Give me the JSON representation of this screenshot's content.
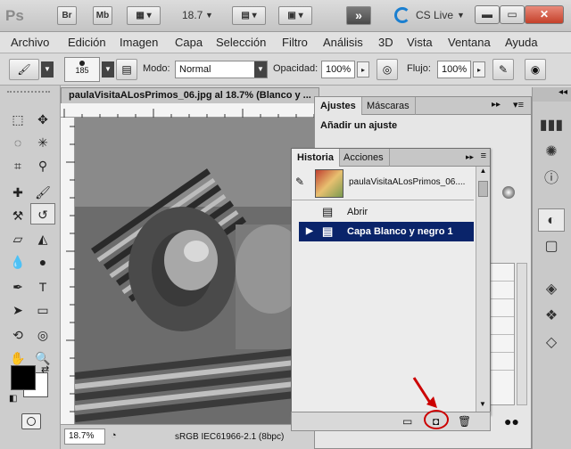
{
  "titlebar": {
    "app": "Ps",
    "bridge": "Br",
    "minibridge": "Mb",
    "zoom": "18.7",
    "cs_live": "CS Live"
  },
  "menu": [
    "Archivo",
    "Edición",
    "Imagen",
    "Capa",
    "Selección",
    "Filtro",
    "Análisis",
    "3D",
    "Vista",
    "Ventana",
    "Ayuda"
  ],
  "options": {
    "brush_size": "185",
    "mode_label": "Modo:",
    "mode_value": "Normal",
    "opacity_label": "Opacidad:",
    "opacity_value": "100%",
    "flow_label": "Flujo:",
    "flow_value": "100%"
  },
  "document": {
    "tab_title": "paulaVisitaALosPrimos_06.jpg al 18.7% (Blanco y ...",
    "zoom": "18.7%",
    "profile": "sRGB IEC61966-2.1 (8bpc)"
  },
  "ajustes": {
    "tabs": [
      "Ajustes",
      "Máscaras"
    ],
    "heading": "Añadir un ajuste"
  },
  "historia": {
    "tabs": [
      "Historia",
      "Acciones"
    ],
    "snapshot_name": "paulaVisitaALosPrimos_06....",
    "states": [
      "Abrir",
      "Capa Blanco y negro 1"
    ]
  },
  "colors": {
    "selection": "#0a246a",
    "annotation": "#cc0000"
  }
}
